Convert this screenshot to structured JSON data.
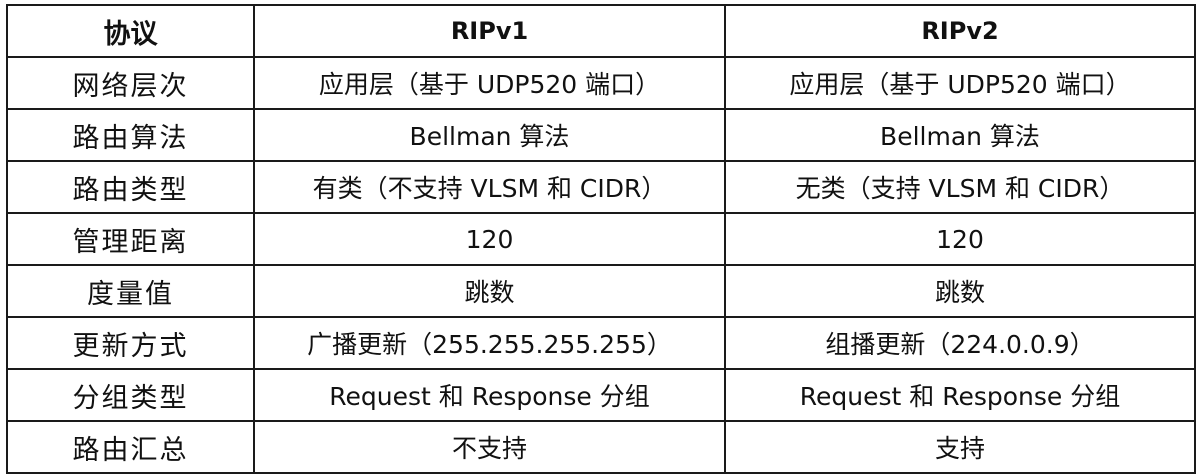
{
  "table": {
    "headers": [
      "协议",
      "RIPv1",
      "RIPv2"
    ],
    "rows": [
      {
        "attribute": "网络层次",
        "ripv1": "应用层（基于 UDP520 端口）",
        "ripv2": "应用层（基于 UDP520 端口）"
      },
      {
        "attribute": "路由算法",
        "ripv1": "Bellman 算法",
        "ripv2": "Bellman 算法"
      },
      {
        "attribute": "路由类型",
        "ripv1": "有类（不支持 VLSM 和 CIDR）",
        "ripv2": "无类（支持 VLSM 和 CIDR）"
      },
      {
        "attribute": "管理距离",
        "ripv1": "120",
        "ripv2": "120"
      },
      {
        "attribute": "度量值",
        "ripv1": "跳数",
        "ripv2": "跳数"
      },
      {
        "attribute": "更新方式",
        "ripv1": "广播更新（255.255.255.255）",
        "ripv2": "组播更新（224.0.0.9）"
      },
      {
        "attribute": "分组类型",
        "ripv1": "Request 和 Response 分组",
        "ripv2": "Request 和 Response 分组"
      },
      {
        "attribute": "路由汇总",
        "ripv1": "不支持",
        "ripv2": "支持"
      }
    ]
  }
}
